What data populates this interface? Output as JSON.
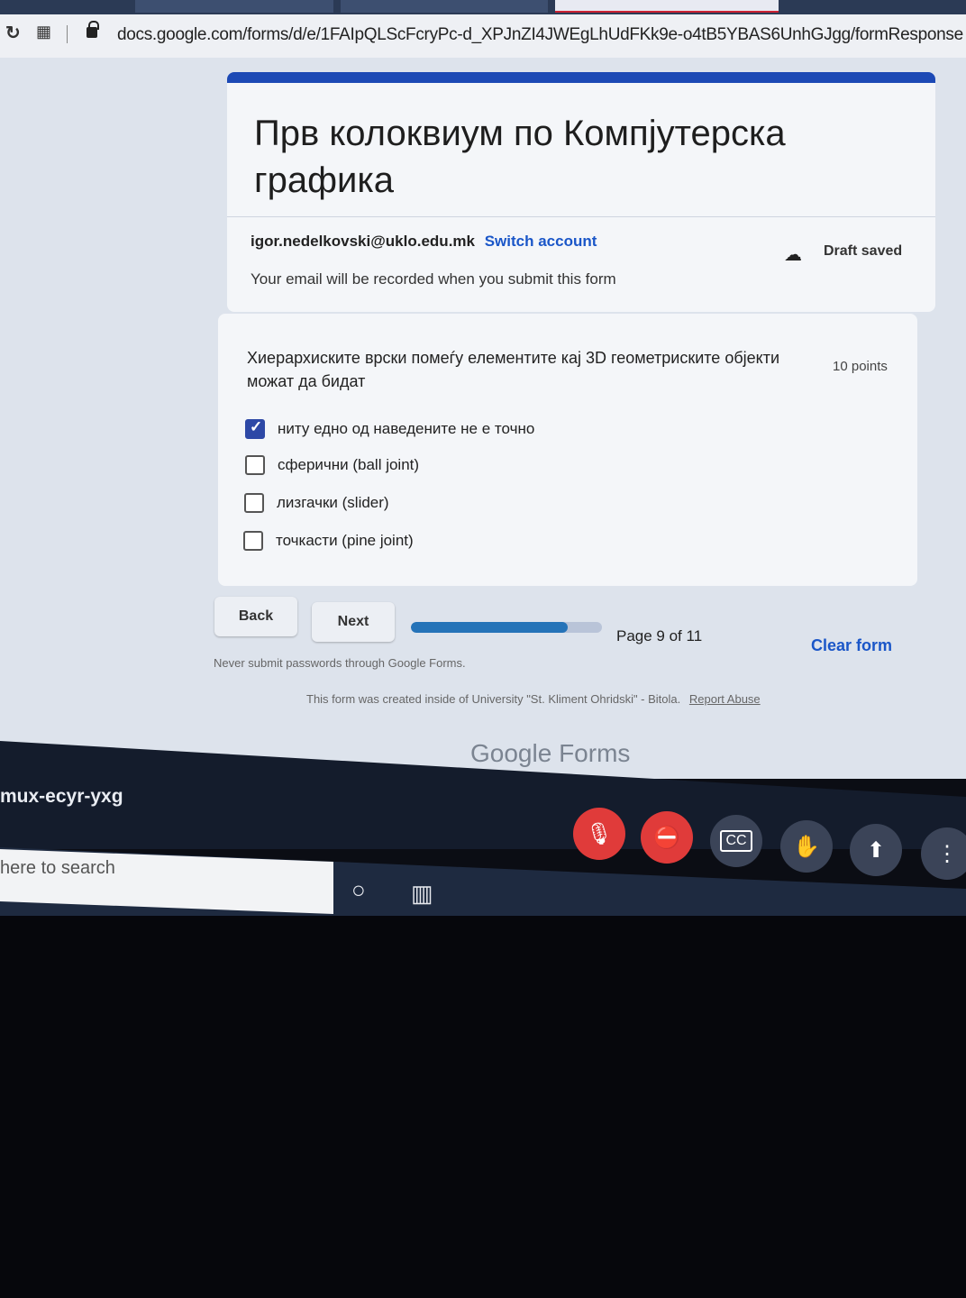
{
  "browser": {
    "url": "docs.google.com/forms/d/e/1FAIpQLScFcryPc-d_XPJnZI4JWEgLhUdFKk9e-o4tB5YBAS6UnhGJgg/formResponse"
  },
  "form": {
    "title": "Прв колоквиум по Компјутерска графика",
    "account_email": "igor.nedelkovski@uklo.edu.mk",
    "switch_account": "Switch account",
    "draft_status": "Draft saved",
    "email_note": "Your email will be recorded when you submit this form",
    "question": {
      "text": "Хиерархиските врски помеѓу елементите кај 3D геометриските објекти можат да бидат",
      "points": "10 points",
      "options": [
        {
          "label": "ниту едно од наведените не е точно",
          "checked": true
        },
        {
          "label": "сферични (ball joint)",
          "checked": false
        },
        {
          "label": "лизгачки (slider)",
          "checked": false
        },
        {
          "label": "точкасти (pine joint)",
          "checked": false
        }
      ]
    },
    "nav": {
      "back": "Back",
      "next": "Next",
      "page_indicator": "Page 9 of 11",
      "progress_fraction": 0.82,
      "clear_form": "Clear form"
    },
    "footer": {
      "password_warning": "Never submit passwords through Google Forms.",
      "created_inside": "This form was created inside of University \"St. Kliment Ohridski\" - Bitola.",
      "report_abuse": "Report Abuse",
      "logo": "Google Forms"
    }
  },
  "meet": {
    "meeting_code": "mux-ecyr-yxg",
    "accent_red": "#e03b3a"
  },
  "taskbar": {
    "search_placeholder": "here to search"
  }
}
